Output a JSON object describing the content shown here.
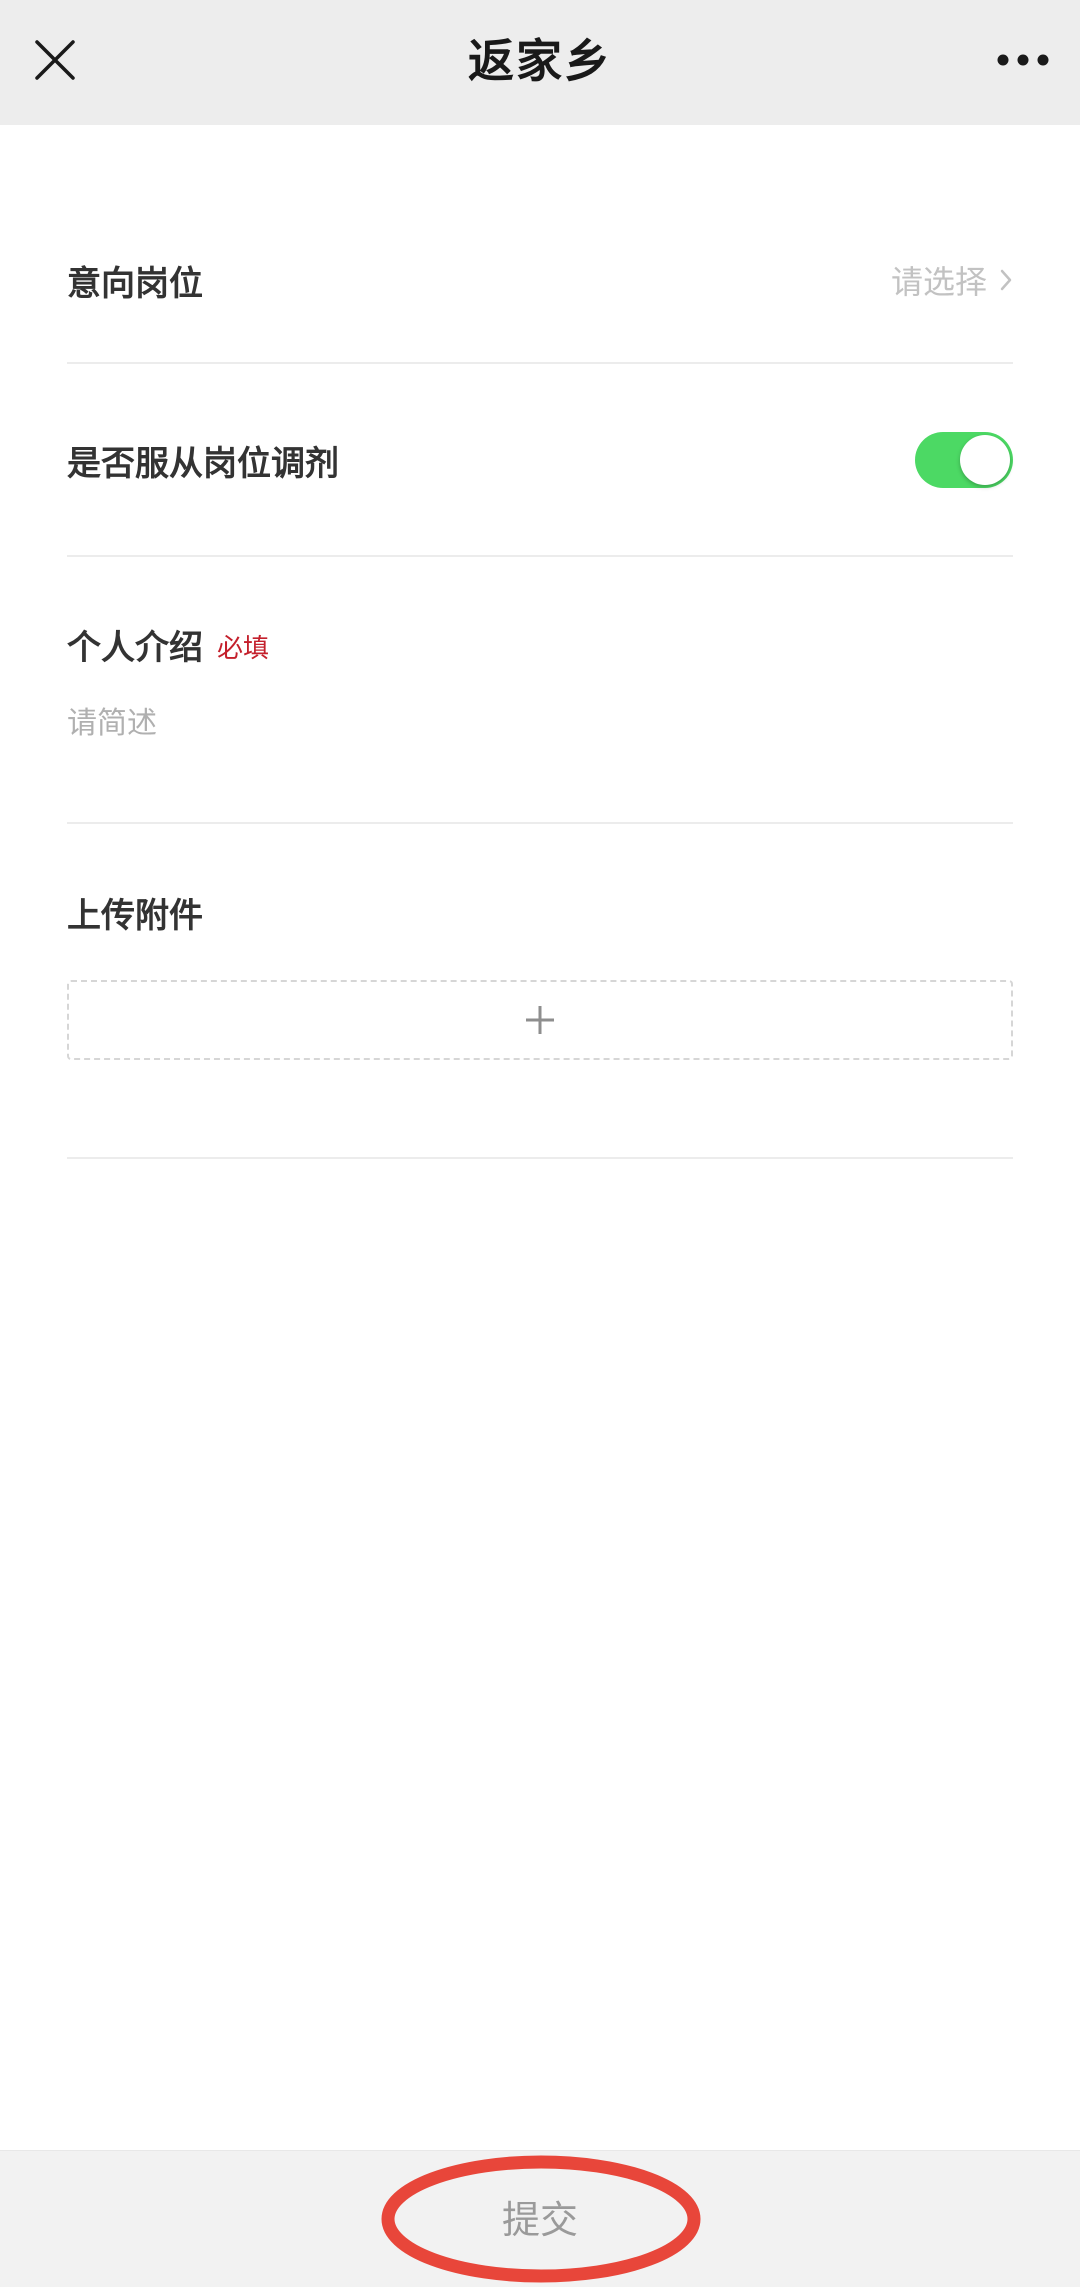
{
  "nav": {
    "title": "返家乡",
    "close_icon": "close-icon",
    "more_icon": "more-horizontal-icon"
  },
  "form": {
    "position": {
      "label": "意向岗位",
      "placeholder": "请选择",
      "icon": "chevron-right-icon"
    },
    "adjust": {
      "label": "是否服从岗位调剂",
      "enabled": true,
      "toggle_color": "#4cd964"
    },
    "intro": {
      "label": "个人介绍",
      "required_tag": "必填",
      "required_color": "#c4202c",
      "placeholder": "请简述",
      "value": ""
    },
    "upload": {
      "label": "上传附件",
      "icon": "plus-icon"
    }
  },
  "footer": {
    "submit_label": "提交",
    "annotation_color": "#e8463a"
  }
}
